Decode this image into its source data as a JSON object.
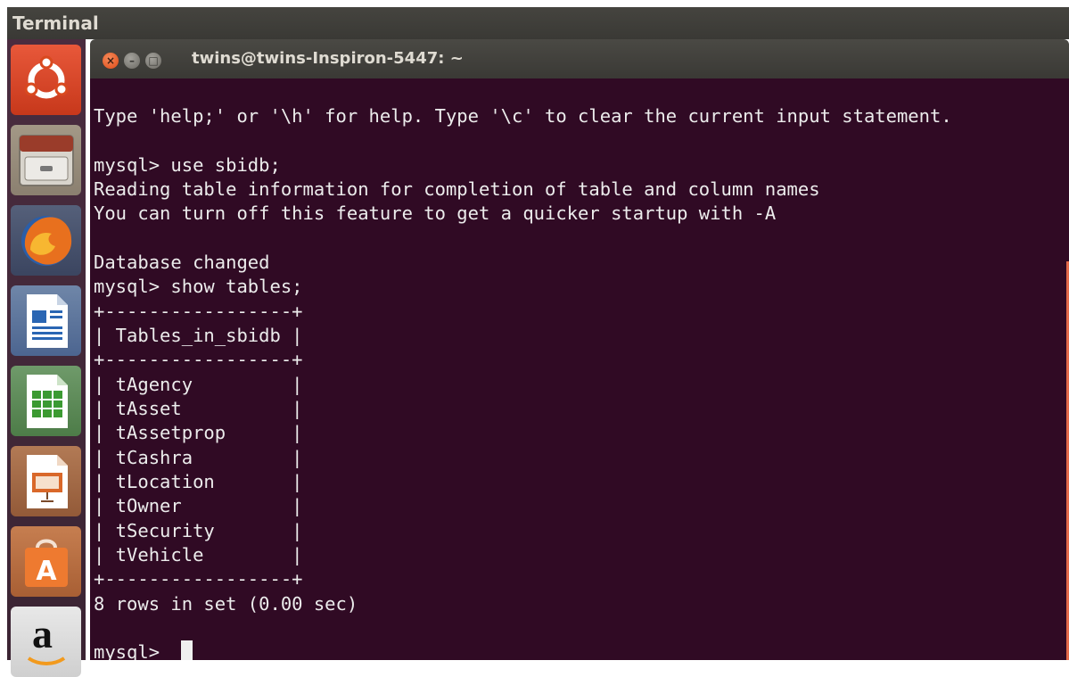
{
  "topbar": {
    "title": "Terminal"
  },
  "window": {
    "title": "twins@twins-Inspiron-5447: ~"
  },
  "launcher": {
    "items": [
      {
        "name": "ubuntu-dash"
      },
      {
        "name": "files"
      },
      {
        "name": "firefox"
      },
      {
        "name": "libreoffice-writer"
      },
      {
        "name": "libreoffice-calc"
      },
      {
        "name": "libreoffice-impress"
      },
      {
        "name": "ubuntu-software-center"
      },
      {
        "name": "amazon"
      }
    ],
    "amazon_glyph": "a"
  },
  "terminal": {
    "lines": [
      "Type 'help;' or '\\h' for help. Type '\\c' to clear the current input statement.",
      "",
      "mysql> use sbidb;",
      "Reading table information for completion of table and column names",
      "You can turn off this feature to get a quicker startup with -A",
      "",
      "Database changed",
      "mysql> show tables;",
      "+-----------------+",
      "| Tables_in_sbidb |",
      "+-----------------+",
      "| tAgency         |",
      "| tAsset          |",
      "| tAssetprop      |",
      "| tCashra         |",
      "| tLocation       |",
      "| tOwner          |",
      "| tSecurity       |",
      "| tVehicle        |",
      "+-----------------+",
      "8 rows in set (0.00 sec)",
      "",
      "mysql> "
    ]
  },
  "colors": {
    "terminal_bg": "#300a24",
    "launcher_bg": "#3b2433",
    "close_button": "#df4a16"
  }
}
